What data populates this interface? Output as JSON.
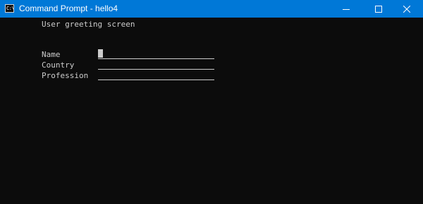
{
  "window": {
    "title": "Command Prompt - hello4",
    "icon_glyph": "C:\\",
    "titlebar_color": "#0078d7",
    "buttons": [
      "minimize-icon",
      "maximize-icon",
      "close-icon"
    ]
  },
  "console": {
    "background": "#0c0c0c",
    "text_color": "#cccccc",
    "heading": "User greeting screen",
    "fields": [
      {
        "label": "Name",
        "value": "",
        "has_cursor": true
      },
      {
        "label": "Country",
        "value": ""
      },
      {
        "label": "Profession",
        "value": ""
      }
    ]
  }
}
